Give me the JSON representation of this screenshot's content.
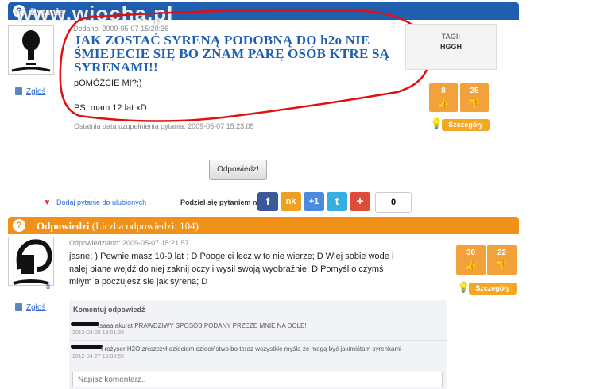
{
  "watermark": "www.wiocha.pl",
  "question_section": {
    "header": "Pytanie",
    "posted_meta": "Dodano: 2009-05-07 15:20:36",
    "title": "JAK ZOSTAĆ SYRENĄ PODOBNĄ DO h2o NIE ŚMIEJECIE SIĘ BO ZNAM PARĘ OSÓB KTRE SĄ SYRENAMI!!",
    "body_line1": "pOMÓŻCIE MI?;)",
    "body_line2": "PS. mam 12 lat xD",
    "updated": "Ostatnia data uzupełnienia pytania: 2009-05-07 15:23:05",
    "report_label": "Zgłoś",
    "tags_label": "TAGI:",
    "tags_value": "HGGH",
    "votes_up": "8",
    "votes_down": "25",
    "details_label": "Szczegóły"
  },
  "answer_button": "Odpowiedz!",
  "share_row": {
    "favorite_label": "Dodaj pytanie do ulubionych",
    "share_label": "Podziel się pytaniem na:",
    "share_buttons": [
      "f",
      "nk",
      "+1",
      "t",
      "+"
    ],
    "count": "0"
  },
  "answers_section": {
    "header": "Odpowiedzi",
    "count_label": "(Liczba odpowiedzi: 104)",
    "answer_meta": "Odpowiedziano: 2009-05-07 15:21:57",
    "answer_text": "jasne; ) Pewnie masz 10-9 lat ; D Pooge ci lecz w to nie wierze; D Wlej sobie wode i nalej piane wejdź do niej zaknij oczy i wysil swoją wyobraźnie; D Pomyśl o czymś miłym a poczujesz sie jak syrena; D",
    "report_label": "Zgłoś",
    "avatar_caption": "d",
    "votes_up": "30",
    "votes_down": "22",
    "details_label": "Szczegóły"
  },
  "comments": {
    "header": "Komentuj odpowiedź",
    "items": [
      {
        "text": "Isaaa akurat PRAWDZIWY SPOSÓB PODANY PRZEZE MNIE NA DOLE!",
        "date": "2012-03-05 13:01:26"
      },
      {
        "text": "I reżyser H2O zniszczył dzieciom dzieciństwo bo teraz wszystkie myślą że mogą być jakimiśtam syrenkami",
        "date": "2012-04-27 19:38:55"
      }
    ],
    "input_placeholder": "Napisz komentarz.."
  },
  "colors": {
    "header_blue": "#1f5fb0",
    "header_orange": "#f0921a",
    "vote_orange": "#f3a13b",
    "scribble_red": "#e01010"
  }
}
